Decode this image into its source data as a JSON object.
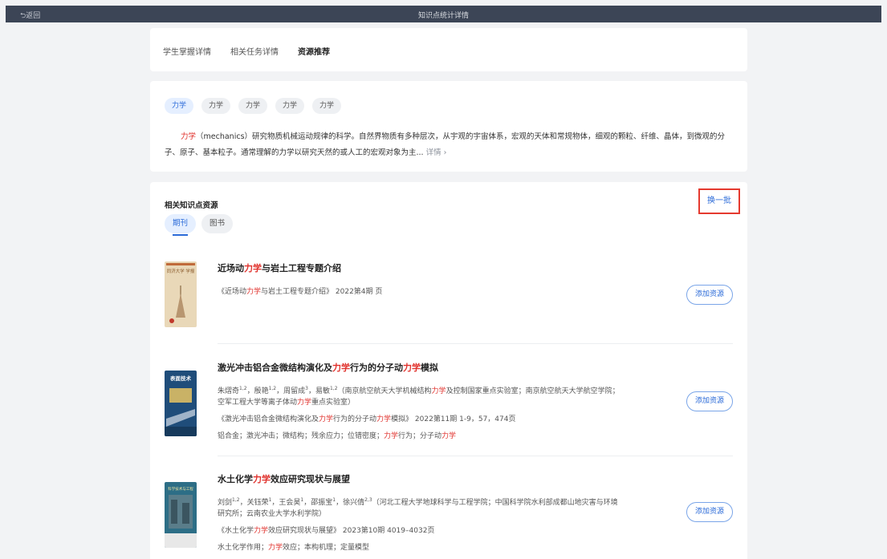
{
  "header": {
    "back_label": "⮌返回",
    "title": "知识点统计详情"
  },
  "tabs": [
    "学生掌握详情",
    "相关任务详情",
    "资源推荐"
  ],
  "active_tab": 2,
  "chips": [
    "力学",
    "力学",
    "力学",
    "力学",
    "力学"
  ],
  "description": {
    "term": "力学",
    "text": "（mechanics）研究物质机械运动规律的科学。自然界物质有多种层次，从宇观的宇宙体系，宏观的天体和常规物体，细观的颗粒、纤维、晶体，到微观的分子、原子、基本粒子。通常理解的力学以研究天然的或人工的宏观对象为主...",
    "more_label": "详情 ›"
  },
  "resources": {
    "title": "相关知识点资源",
    "refresh_label": "换一批",
    "types": [
      "期刊",
      "图书"
    ],
    "add_label": "添加资源",
    "items": [
      {
        "title_parts": [
          "近场动",
          "力学",
          "与岩土工程专题介绍"
        ],
        "source_parts": [
          "《近场动",
          "力学",
          "与岩土工程专题介绍》 2022第4期 页"
        ]
      },
      {
        "title_parts": [
          "激光冲击铝合金微结构演化及",
          "力学",
          "行为的分子动",
          "力学",
          "模拟"
        ],
        "authors_line1_parts": [
          "朱熠奇",
          "1,2",
          "，殷艳",
          "1,2",
          "，周留成",
          "3",
          "，易敏",
          "1,2",
          "（南京航空航天大学机械结构",
          "力学",
          "及控制国家重点实验室；南京航空航天大学航空学院；"
        ],
        "authors_line2_parts": [
          "空军工程大学等离子体动",
          "力学",
          "重点实验室）"
        ],
        "source_parts": [
          "《激光冲击铝合金微结构演化及",
          "力学",
          "行为的分子动",
          "力学",
          "模拟》 2022第11期 1-9，57，474页"
        ],
        "keywords_parts": [
          "铝合金；激光冲击；微结构；残余应力；位错密度；",
          "力学",
          "行为；分子动",
          "力学",
          ""
        ]
      },
      {
        "title_parts": [
          "水土化学",
          "力学",
          "效应研究现状与展望"
        ],
        "authors_line1_parts": [
          "刘剑",
          "1,2",
          "，关钰荣",
          "1",
          "，王会昊",
          "1",
          "，邵振宝",
          "1",
          "，徐兴倩",
          "2,3",
          "（河北工程大学地球科学与工程学院；中国科学院水利部成都山地灾害与环境"
        ],
        "authors_line2_parts": [
          "研究所；云南农业大学水利学院）"
        ],
        "source_parts": [
          "《水土化学",
          "力学",
          "效应研究现状与展望》 2023第10期 4019–4032页"
        ],
        "keywords_parts": [
          "水土化学作用；",
          "力学",
          "效应；本构机理；定量模型"
        ]
      }
    ]
  },
  "covers": [
    {
      "name": "同济大学学报",
      "bg": "#e9d8b8",
      "text": "同济大学 学报",
      "color": "#8a5a2b"
    },
    {
      "name": "表面技术",
      "bg": "#1f4d7a",
      "text": "表面技术",
      "color": "#ffffff"
    },
    {
      "name": "科学技术与工程",
      "bg": "#2d6e86",
      "text": "科学技术与工程",
      "color": "#f2e6a0"
    }
  ],
  "colors": {
    "accent": "#2a6ad8",
    "highlight": "#e0302b",
    "topbar": "#3c4556",
    "outline": "#e53a2f"
  }
}
